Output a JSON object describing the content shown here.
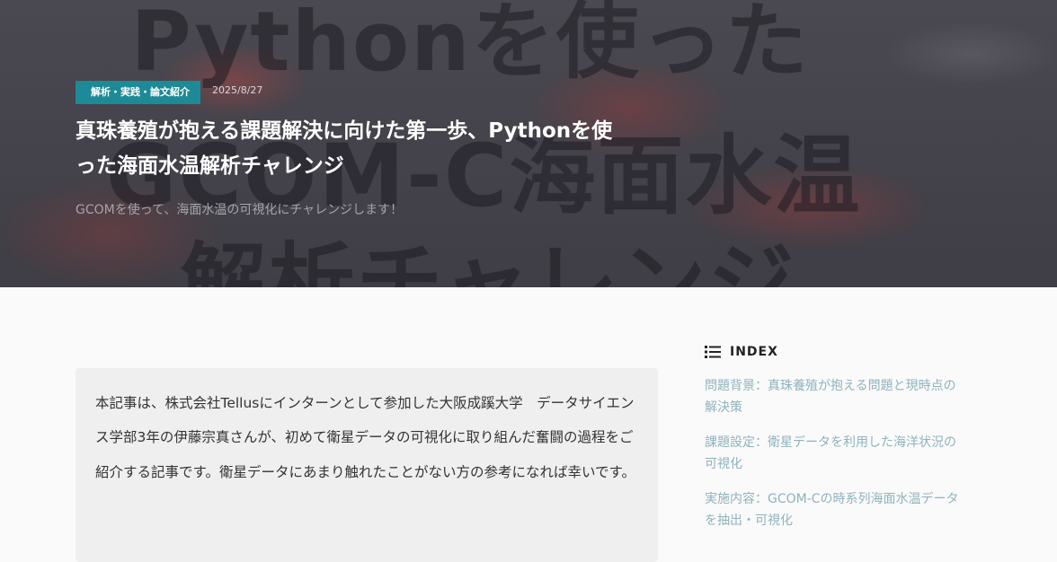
{
  "hero": {
    "bg_lines": [
      "Pythonを使った",
      "GCOM-C海面水温",
      "解析チャレンジ"
    ],
    "category": "解析・実践・論文紹介",
    "date": "2025/8/27",
    "title_line1": "真珠養殖が抱える課題解決に向けた第一歩、Pythonを使",
    "title_line2": "った海面水温解析チャレンジ",
    "lead": "GCOMを使って、海面水温の可視化にチャレンジします！"
  },
  "intro": {
    "text": "本記事は、株式会社Tellusにインターンとして参加した大阪成蹊大学　データサイエンス学部3年の伊藤宗真さんが、初めて衛星データの可視化に取り組んだ奮闘の過程をご紹介する記事です。衛星データにあまり触れたことがない方の参考になれば幸いです。"
  },
  "toc": {
    "icon": "list-icon",
    "title": "INDEX",
    "items": [
      {
        "label": "問題背景：真珠養殖が抱える問題と現時点の解決策"
      },
      {
        "label": "課題設定：衛星データを利用した海洋状況の可視化"
      },
      {
        "label": "実施内容：GCOM-Cの時系列海面水温データを抽出・可視化"
      }
    ]
  },
  "colors": {
    "badge": "#1d8a97",
    "toc_link": "#8fb3bd",
    "hero_bg": "#434149"
  }
}
